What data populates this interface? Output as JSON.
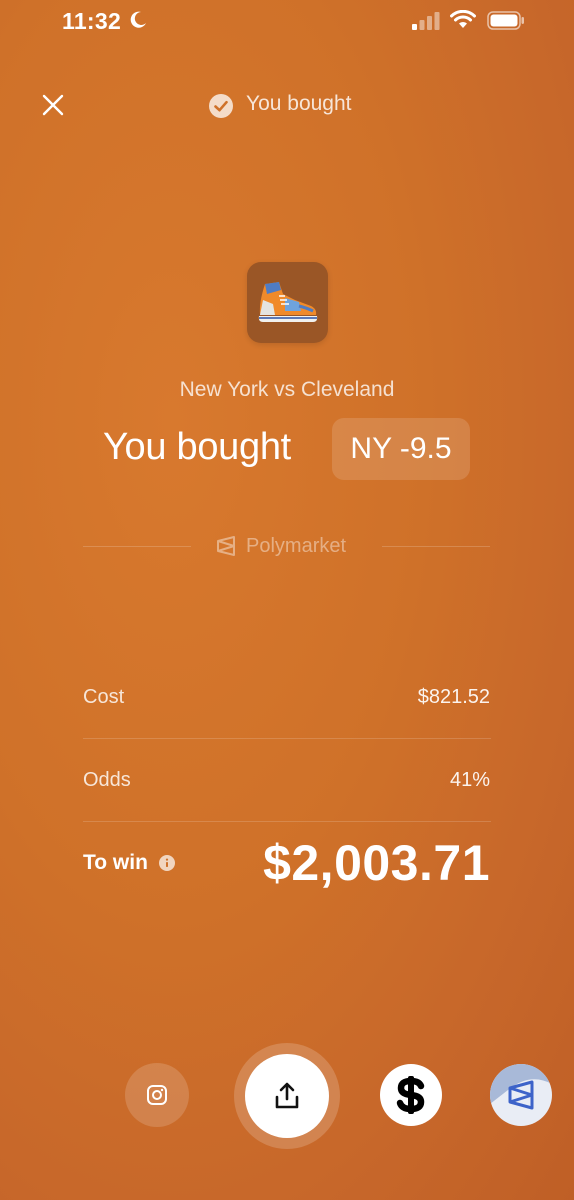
{
  "status_bar": {
    "time": "11:32"
  },
  "header": {
    "title": "You bought"
  },
  "trade": {
    "matchup": "New York vs Cleveland",
    "headline": "You bought",
    "position": "NY -9.5"
  },
  "brand": {
    "name": "Polymarket"
  },
  "details": {
    "cost_label": "Cost",
    "cost_value": "$821.52",
    "odds_label": "Odds",
    "odds_value": "41%",
    "win_label": "To win",
    "win_value": "$2,003.71"
  },
  "share_targets": [
    "instagram-icon",
    "share-icon",
    "cash-app-icon",
    "polymarket-app-icon"
  ],
  "colors": {
    "background": "#cf7129",
    "accent": "#ffffff"
  }
}
